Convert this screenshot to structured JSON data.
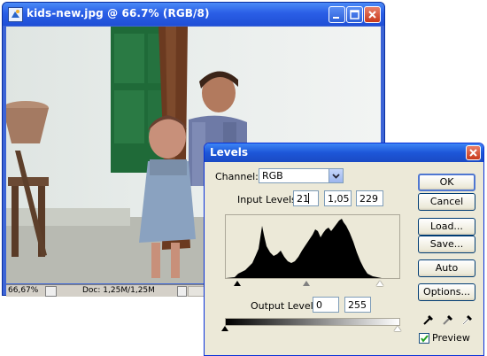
{
  "image_window": {
    "title": "kids-new.jpg @ 66.7% (RGB/8)",
    "status_zoom": "66,67%",
    "status_doc": "Doc: 1,25M/1,25M"
  },
  "levels_dialog": {
    "title": "Levels",
    "channel_label": "Channel:",
    "channel_value": "RGB",
    "input_levels_label": "Input Levels:",
    "input_black": "21",
    "input_gamma": "1,05",
    "input_white": "229",
    "output_levels_label": "Output Levels:",
    "output_black": "0",
    "output_white": "255",
    "buttons": {
      "ok": "OK",
      "cancel": "Cancel",
      "load": "Load...",
      "save": "Save...",
      "auto": "Auto",
      "options": "Options..."
    },
    "preview_label": "Preview",
    "preview_checked": true
  }
}
